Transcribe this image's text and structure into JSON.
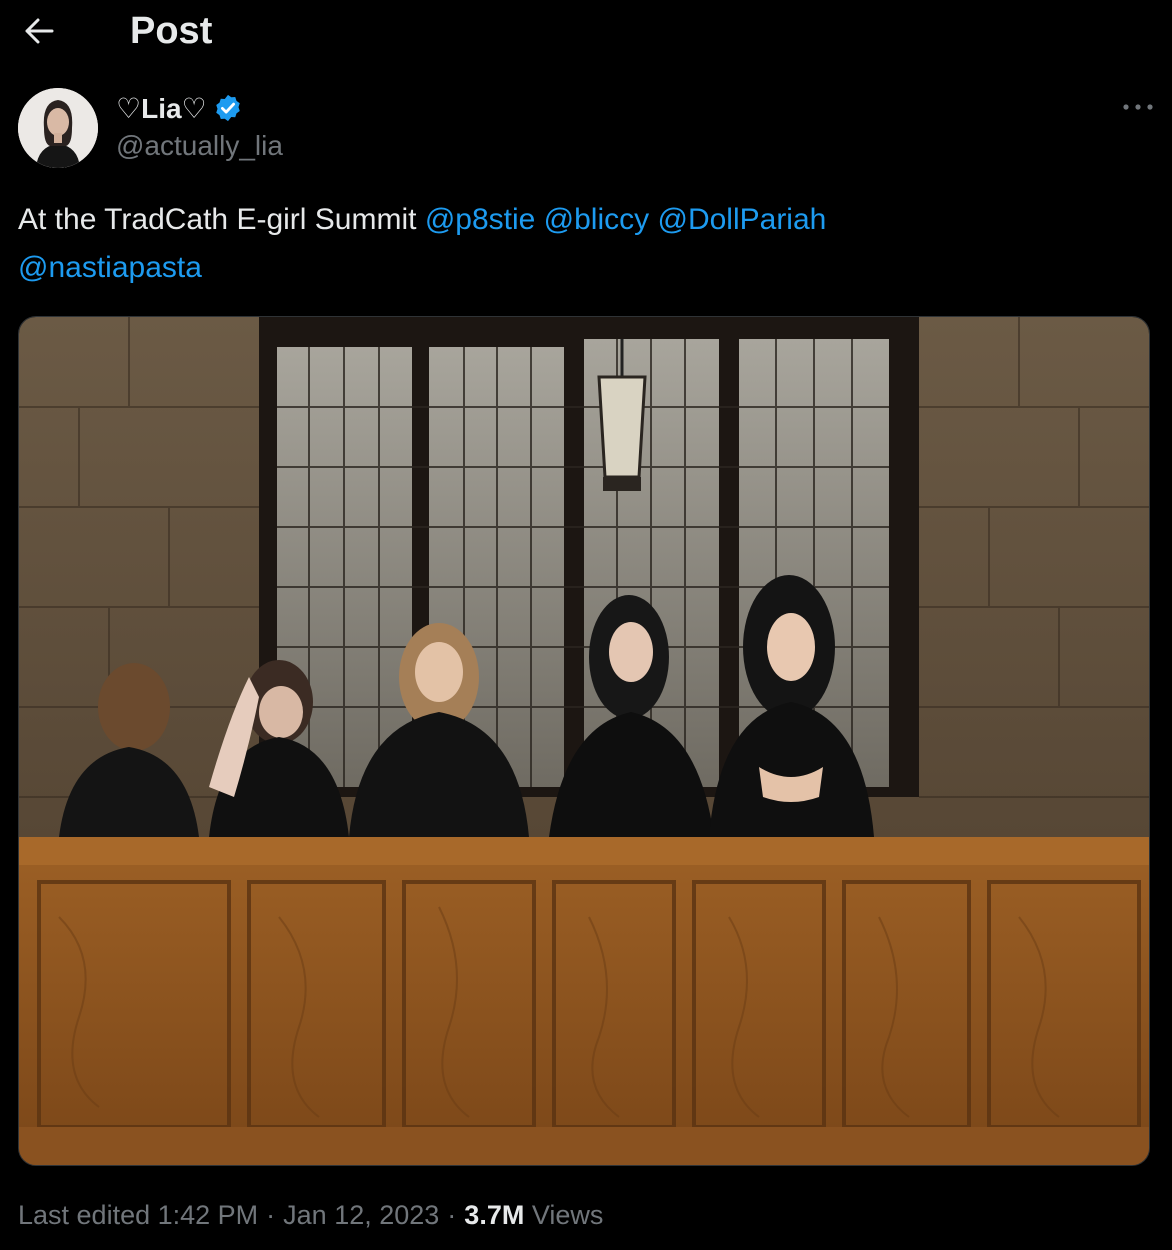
{
  "header": {
    "title": "Post",
    "back_icon": "arrow-left-icon"
  },
  "author": {
    "display_name": "♡Lia♡",
    "handle": "@actually_lia",
    "verified_icon": "verified-badge-icon",
    "verified_color": "#1d9bf0"
  },
  "tweet": {
    "text_prefix": "At the TradCath E-girl Summit ",
    "mentions": [
      "@p8stie",
      "@bliccy",
      "@DollPariah",
      "@nastiapasta"
    ]
  },
  "meta": {
    "edited": "Last edited 1:42 PM",
    "sep1": "·",
    "date": "Jan 12, 2023",
    "sep2": "·",
    "views_count": "3.7M",
    "views_label": "Views"
  },
  "colors": {
    "accent": "#1d9bf0",
    "muted": "#71767b",
    "text": "#e7e9ea",
    "background": "#000000"
  }
}
